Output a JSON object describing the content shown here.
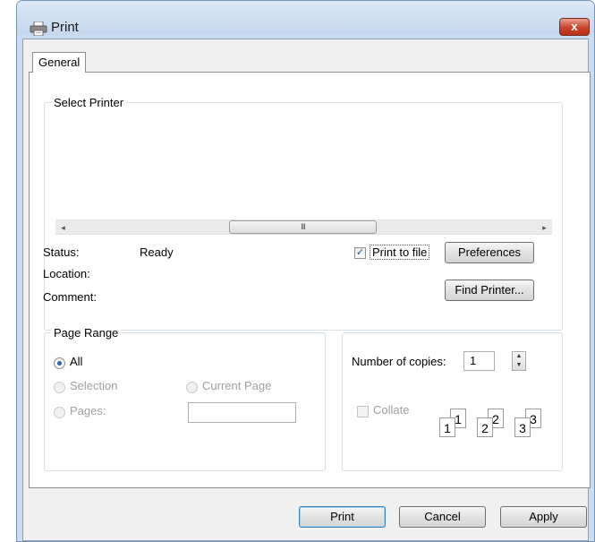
{
  "window": {
    "title": "Print",
    "close_glyph": "x"
  },
  "tabs": [
    {
      "label": "General"
    }
  ],
  "select_printer": {
    "group_label": "Select Printer",
    "scroll": {
      "left_arrow": "◂",
      "right_arrow": "▸",
      "thumb_glyph": "III"
    },
    "status_label": "Status:",
    "status_value": "Ready",
    "location_label": "Location:",
    "comment_label": "Comment:",
    "print_to_file": {
      "label": "Print to file",
      "checked": true
    },
    "preferences_button": "Preferences",
    "find_printer_button": "Find Printer..."
  },
  "page_range": {
    "group_label": "Page Range",
    "options": {
      "all": "All",
      "selection": "Selection",
      "current_page": "Current Page",
      "pages": "Pages:"
    },
    "selected": "all",
    "pages_value": ""
  },
  "copies": {
    "label": "Number of copies:",
    "value": "1",
    "collate_label": "Collate",
    "collate_checked": false,
    "collate_pages": [
      "1",
      "1",
      "2",
      "2",
      "3",
      "3"
    ]
  },
  "buttons": {
    "print": "Print",
    "cancel": "Cancel",
    "apply": "Apply"
  },
  "icons": [
    "printer-icon",
    "close-icon",
    "scroll-left-icon",
    "scroll-right-icon",
    "spin-up-icon",
    "spin-down-icon",
    "collate-icon"
  ]
}
